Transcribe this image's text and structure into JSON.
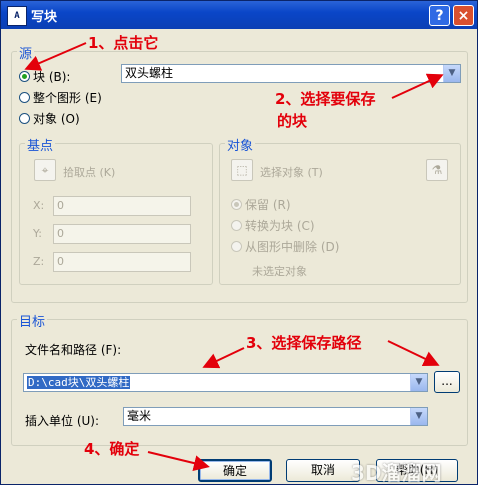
{
  "window": {
    "title": "写块",
    "app_icon": "AutoCAD",
    "help_label": "?",
    "close_label": "×"
  },
  "source": {
    "legend": "源",
    "radios": [
      {
        "label": "块 (B):",
        "checked": true
      },
      {
        "label": "整个图形 (E)",
        "checked": false
      },
      {
        "label": "对象 (O)",
        "checked": false
      }
    ],
    "block_select": "双头螺柱"
  },
  "base_point": {
    "legend": "基点",
    "pick_label": "拾取点 (K)",
    "fields": [
      {
        "label": "X:",
        "value": "0"
      },
      {
        "label": "Y:",
        "value": "0"
      },
      {
        "label": "Z:",
        "value": "0"
      }
    ]
  },
  "objects": {
    "legend": "对象",
    "select_label": "选择对象 (T)",
    "radios": [
      {
        "label": "保留 (R)",
        "checked": true
      },
      {
        "label": "转换为块 (C)",
        "checked": false
      },
      {
        "label": "从图形中删除 (D)",
        "checked": false
      }
    ],
    "status": "未选定对象"
  },
  "target": {
    "legend": "目标",
    "path_label": "文件名和路径 (F):",
    "path_value": "D:\\cad块\\双头螺柱",
    "browse_label": "...",
    "unit_label": "插入单位 (U):",
    "unit_value": "毫米"
  },
  "buttons": {
    "ok": "确定",
    "cancel": "取消",
    "help": "帮助(H)"
  },
  "annotations": {
    "a1": "1、点击它",
    "a2_line1": "2、选择要保存",
    "a2_line2": "的块",
    "a3": "3、选择保存路径",
    "a4": "4、确定"
  },
  "watermark": "3D溜溜网",
  "colors": {
    "title_bar": "#0a46c8",
    "annotation": "#e3000b",
    "legend": "#1a55d6"
  }
}
